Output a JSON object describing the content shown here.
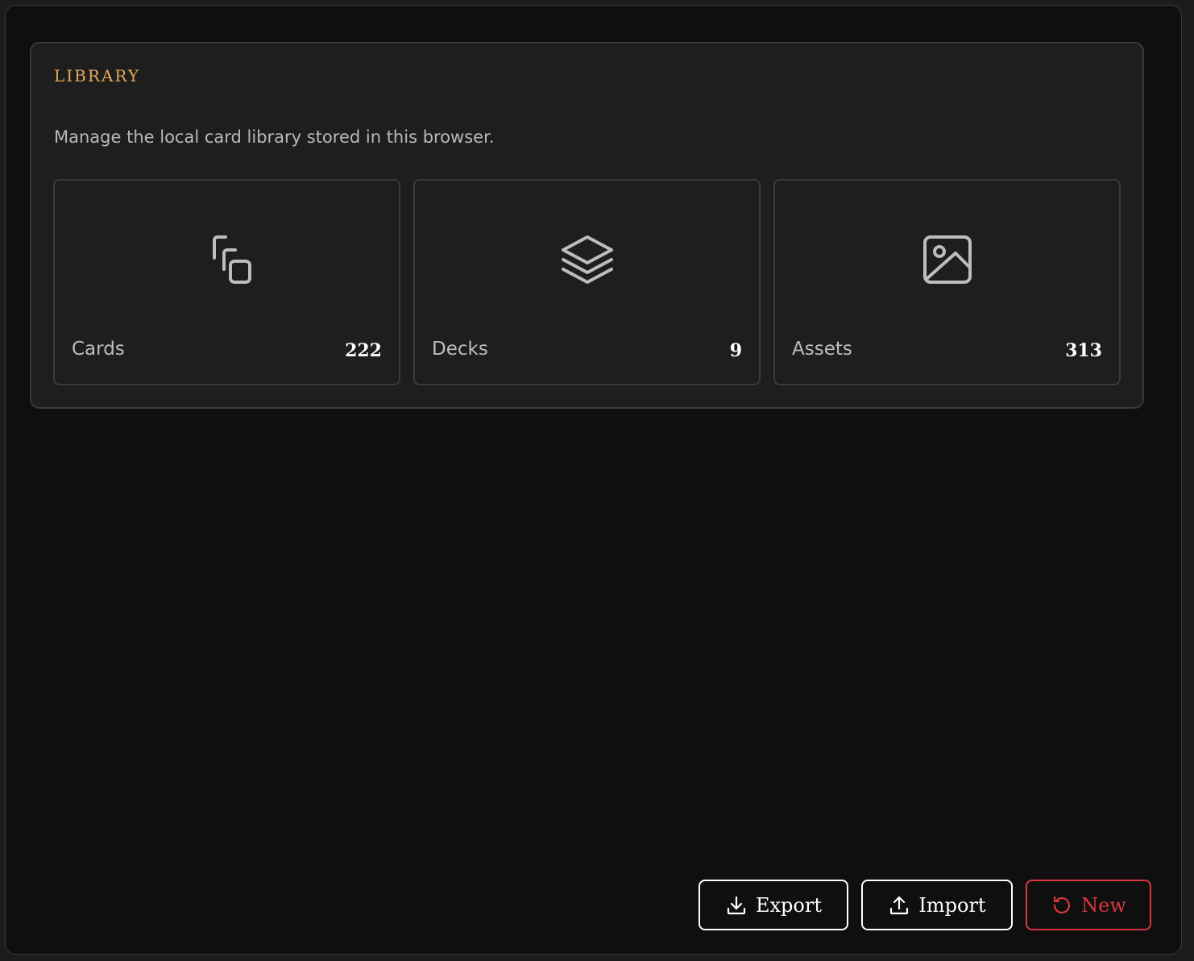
{
  "library": {
    "title": "LIBRARY",
    "description": "Manage the local card library stored in this browser.",
    "tiles": [
      {
        "label": "Cards",
        "count": "222",
        "icon": "cards-icon"
      },
      {
        "label": "Decks",
        "count": "9",
        "icon": "layers-icon"
      },
      {
        "label": "Assets",
        "count": "313",
        "icon": "image-icon"
      }
    ]
  },
  "actions": {
    "export_label": "Export",
    "import_label": "Import",
    "new_label": "New"
  },
  "colors": {
    "accent": "#e2a857",
    "danger": "#d9363e",
    "background": "#0f0f0f",
    "panel": "#1e1e1e"
  }
}
